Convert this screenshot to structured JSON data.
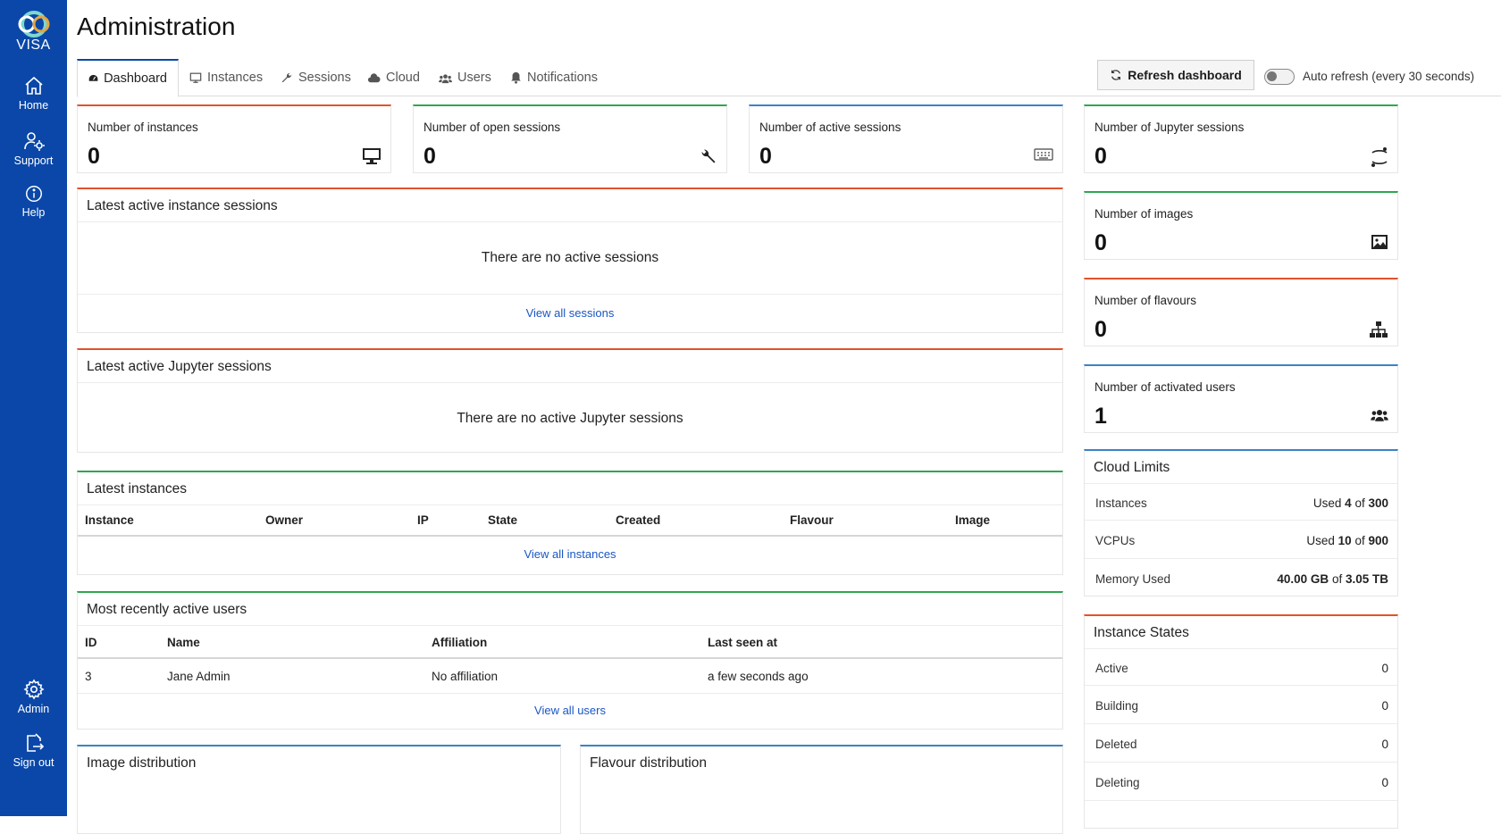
{
  "sidebar": {
    "logo_text": "VISA",
    "items": [
      {
        "label": "Home",
        "icon": "home-icon"
      },
      {
        "label": "Support",
        "icon": "support-icon"
      },
      {
        "label": "Help",
        "icon": "help-icon"
      },
      {
        "label": "Admin",
        "icon": "gear-icon"
      },
      {
        "label": "Sign out",
        "icon": "sign-out-icon"
      }
    ]
  },
  "header": {
    "title": "Administration",
    "tabs": [
      {
        "label": "Dashboard",
        "icon": "dashboard-icon",
        "active": true
      },
      {
        "label": "Instances",
        "icon": "monitor-icon"
      },
      {
        "label": "Sessions",
        "icon": "wrench-icon"
      },
      {
        "label": "Cloud",
        "icon": "cloud-icon"
      },
      {
        "label": "Users",
        "icon": "users-icon"
      },
      {
        "label": "Notifications",
        "icon": "bell-icon"
      }
    ],
    "refresh_label": "Refresh dashboard",
    "auto_refresh_label": "Auto refresh (every 30 seconds)",
    "auto_refresh_on": false
  },
  "stats": {
    "instances": {
      "label": "Number of instances",
      "value": "0",
      "icon": "monitor-icon"
    },
    "open_sessions": {
      "label": "Number of open sessions",
      "value": "0",
      "icon": "wrench-icon"
    },
    "active_sessions": {
      "label": "Number of active sessions",
      "value": "0",
      "icon": "keyboard-icon"
    },
    "jupyter_sessions": {
      "label": "Number of Jupyter sessions",
      "value": "0",
      "icon": "jupyter-icon"
    },
    "images": {
      "label": "Number of images",
      "value": "0",
      "icon": "image-icon"
    },
    "flavours": {
      "label": "Number of flavours",
      "value": "0",
      "icon": "sitemap-icon"
    },
    "activated_users": {
      "label": "Number of activated users",
      "value": "1",
      "icon": "users-icon"
    }
  },
  "sessions": {
    "title": "Latest active instance sessions",
    "empty": "There are no active sessions",
    "link": "View all sessions"
  },
  "jupyter": {
    "title": "Latest active Jupyter sessions",
    "empty": "There are no active Jupyter sessions"
  },
  "instances_table": {
    "title": "Latest instances",
    "columns": [
      "Instance",
      "Owner",
      "IP",
      "State",
      "Created",
      "Flavour",
      "Image"
    ],
    "link": "View all instances"
  },
  "users_table": {
    "title": "Most recently active users",
    "columns": [
      "ID",
      "Name",
      "Affiliation",
      "Last seen at"
    ],
    "rows": [
      {
        "id": "3",
        "name": "Jane Admin",
        "affiliation": "No affiliation",
        "last_seen": "a few seconds ago"
      }
    ],
    "link": "View all users"
  },
  "image_distribution": {
    "title": "Image distribution"
  },
  "flavour_distribution": {
    "title": "Flavour distribution"
  },
  "cloud_limits": {
    "title": "Cloud Limits",
    "used_word": "Used",
    "of_word": "of",
    "rows": [
      {
        "label": "Instances",
        "used": "4",
        "total": "300"
      },
      {
        "label": "VCPUs",
        "used": "10",
        "total": "900"
      },
      {
        "label": "Memory Used",
        "used": "40.00 GB",
        "total": "3.05 TB"
      }
    ]
  },
  "instance_states": {
    "title": "Instance States",
    "rows": [
      {
        "label": "Active",
        "value": "0"
      },
      {
        "label": "Building",
        "value": "0"
      },
      {
        "label": "Deleted",
        "value": "0"
      },
      {
        "label": "Deleting",
        "value": "0"
      }
    ]
  },
  "colors": {
    "sidebar": "#0a47a8",
    "accent_red": "#e0532c",
    "accent_green": "#2fa64f",
    "accent_blue": "#3b82c4",
    "link": "#1a56c4"
  }
}
